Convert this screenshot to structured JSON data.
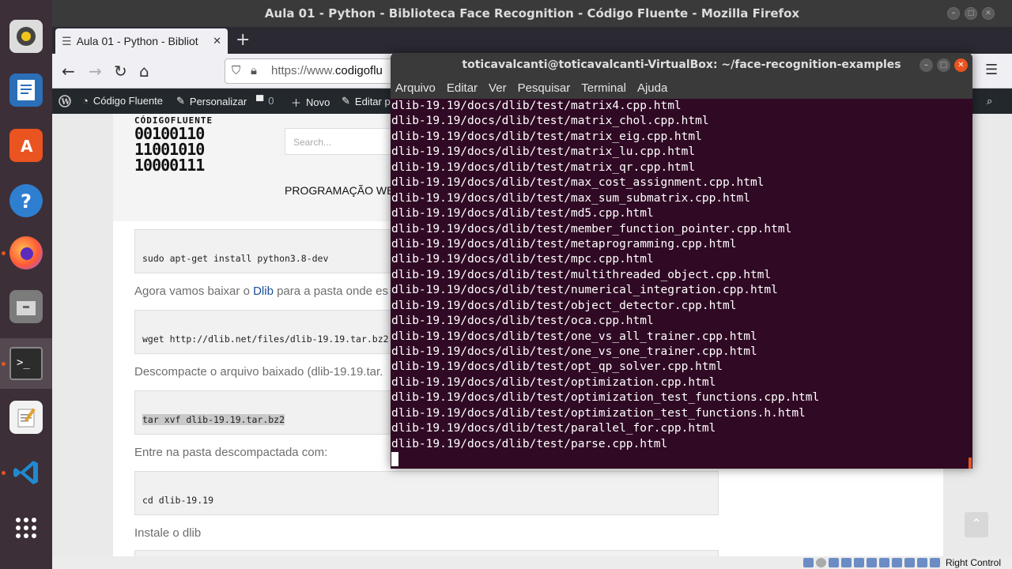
{
  "firefox": {
    "window_title": "Aula 01 - Python - Biblioteca Face Recognition - Código Fluente - Mozilla Firefox",
    "tab_title": "Aula 01 - Python - Bibliot",
    "url_prefix": "https://www.",
    "url_domain": "codigoflu"
  },
  "wp_bar": {
    "site": "Código Fluente",
    "customize": "Personalizar",
    "comments": "0",
    "new": "Novo",
    "edit": "Editar p"
  },
  "site": {
    "logo_name": "CÓDIGOFLUENTE",
    "logo_bits": [
      "00100110",
      "11001010",
      "10000111"
    ],
    "search_placeholder": "Search...",
    "nav": "PROGRAMAÇÃO WEB"
  },
  "article": {
    "code1": "sudo apt-get install python3.8-dev",
    "para1_pre": "Agora vamos baixar o ",
    "para1_link": "Dlib",
    "para1_post": " para a pasta onde es",
    "code2": "wget http://dlib.net/files/dlib-19.19.tar.bz2",
    "para2": "Descompacte o arquivo baixado (dlib-19.19.tar.",
    "code3": "tar xvf dlib-19.19.tar.bz2",
    "para3": "Entre na pasta descompactada com:",
    "code4": "cd dlib-19.19",
    "para4": "Instale o dlib"
  },
  "terminal": {
    "title": "toticavalcanti@toticavalcanti-VirtualBox: ~/face-recognition-examples",
    "menu": [
      "Arquivo",
      "Editar",
      "Ver",
      "Pesquisar",
      "Terminal",
      "Ajuda"
    ],
    "lines": [
      "dlib-19.19/docs/dlib/test/matrix4.cpp.html",
      "dlib-19.19/docs/dlib/test/matrix_chol.cpp.html",
      "dlib-19.19/docs/dlib/test/matrix_eig.cpp.html",
      "dlib-19.19/docs/dlib/test/matrix_lu.cpp.html",
      "dlib-19.19/docs/dlib/test/matrix_qr.cpp.html",
      "dlib-19.19/docs/dlib/test/max_cost_assignment.cpp.html",
      "dlib-19.19/docs/dlib/test/max_sum_submatrix.cpp.html",
      "dlib-19.19/docs/dlib/test/md5.cpp.html",
      "dlib-19.19/docs/dlib/test/member_function_pointer.cpp.html",
      "dlib-19.19/docs/dlib/test/metaprogramming.cpp.html",
      "dlib-19.19/docs/dlib/test/mpc.cpp.html",
      "dlib-19.19/docs/dlib/test/multithreaded_object.cpp.html",
      "dlib-19.19/docs/dlib/test/numerical_integration.cpp.html",
      "dlib-19.19/docs/dlib/test/object_detector.cpp.html",
      "dlib-19.19/docs/dlib/test/oca.cpp.html",
      "dlib-19.19/docs/dlib/test/one_vs_all_trainer.cpp.html",
      "dlib-19.19/docs/dlib/test/one_vs_one_trainer.cpp.html",
      "dlib-19.19/docs/dlib/test/opt_qp_solver.cpp.html",
      "dlib-19.19/docs/dlib/test/optimization.cpp.html",
      "dlib-19.19/docs/dlib/test/optimization_test_functions.cpp.html",
      "dlib-19.19/docs/dlib/test/optimization_test_functions.h.html",
      "dlib-19.19/docs/dlib/test/parallel_for.cpp.html",
      "dlib-19.19/docs/dlib/test/parse.cpp.html"
    ]
  },
  "vbox": {
    "host_key": "Right Control"
  },
  "dock": {
    "apps": [
      "rhythmbox-icon",
      "writer-icon",
      "software-center-icon",
      "help-icon",
      "firefox-icon",
      "files-icon",
      "terminal-icon",
      "text-editor-icon",
      "vscode-icon",
      "show-apps-icon"
    ]
  },
  "colors": {
    "terminal_bg": "#300a24",
    "ubuntu_orange": "#e95420",
    "dock_bg": "#3c2f38"
  }
}
